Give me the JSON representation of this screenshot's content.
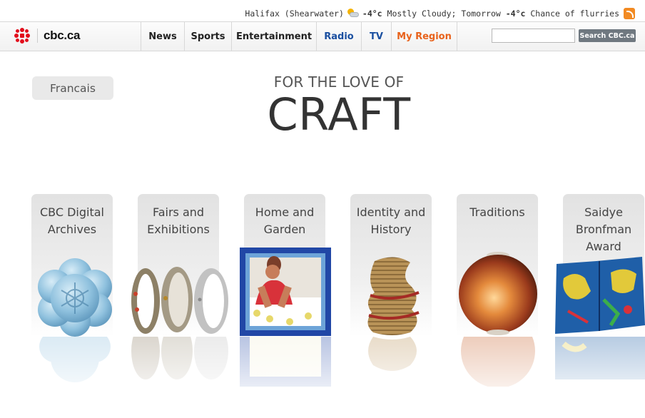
{
  "weather": {
    "location": "Halifax (Shearwater)",
    "current_temp": "-4°c",
    "current_condition": "Mostly Cloudy;",
    "tomorrow_label": "Tomorrow",
    "tomorrow_temp": "-4°c",
    "tomorrow_condition": "Chance of flurries"
  },
  "header": {
    "brand": "cbc.ca",
    "nav": [
      "News",
      "Sports",
      "Entertainment",
      "Radio",
      "TV",
      "My Region"
    ],
    "search_button": "Search CBC.ca",
    "search_value": ""
  },
  "language_button": "Francais",
  "title": {
    "top": "FOR THE LOVE OF",
    "main": "CRAFT"
  },
  "categories": [
    {
      "label": "CBC Digital Archives",
      "art": "blue-ceramic-flower-bowl"
    },
    {
      "label": "Fairs and Exhibitions",
      "art": "silver-rings"
    },
    {
      "label": "Home and Garden",
      "art": "beaded-woman-picture"
    },
    {
      "label": "Identity and History",
      "art": "woven-grass-basket"
    },
    {
      "label": "Traditions",
      "art": "glowing-glass-orb"
    },
    {
      "label": "Saidye Bronfman Award",
      "art": "painted-animal-panel"
    }
  ],
  "colors": {
    "accent_orange": "#e8621b",
    "link_blue": "#1a4fa0",
    "cbc_red": "#e20f1d"
  }
}
